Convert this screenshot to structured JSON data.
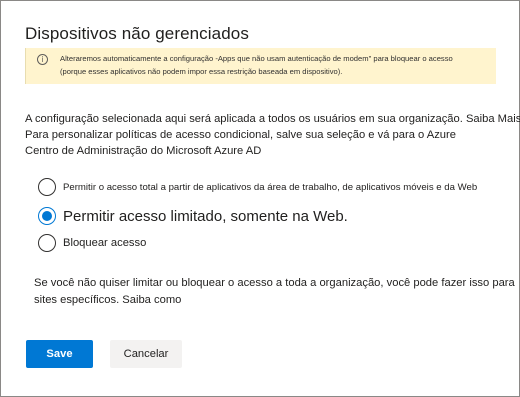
{
  "dialog": {
    "title": "Dispositivos não gerenciados"
  },
  "warning": {
    "icon": "info-icon",
    "background": "#fff4ce",
    "line1": "Alteraremos automaticamente a configuração -Apps que não usam autenticação de modem\" para bloquear o acesso",
    "line2": "(porque esses aplicativos não podem impor essa restrição baseada em dispositivo)."
  },
  "description": {
    "line1": "A configuração selecionada aqui será aplicada a todos os usuários em sua organização. Saiba Mais.",
    "line2": "Para personalizar políticas de acesso condicional, salve sua seleção e vá para o Azure",
    "line3": "Centro de Administração do Microsoft Azure AD"
  },
  "options": [
    {
      "label": "Permitir o acesso total a partir de aplicativos da área de trabalho, de aplicativos móveis e da Web",
      "selected": false
    },
    {
      "label": "Permitir acesso limitado, somente na Web.",
      "selected": true
    },
    {
      "label": "Bloquear acesso",
      "selected": false
    }
  ],
  "note": {
    "line1": "Se você não quiser limitar ou bloquear o acesso a toda a organização, você pode fazer isso para",
    "line2": "sites específicos. Saiba como"
  },
  "buttons": {
    "save_label": "Save",
    "cancel_label": "Cancelar"
  },
  "colors": {
    "accent": "#0078d4",
    "warning_background": "#fff4ce"
  }
}
